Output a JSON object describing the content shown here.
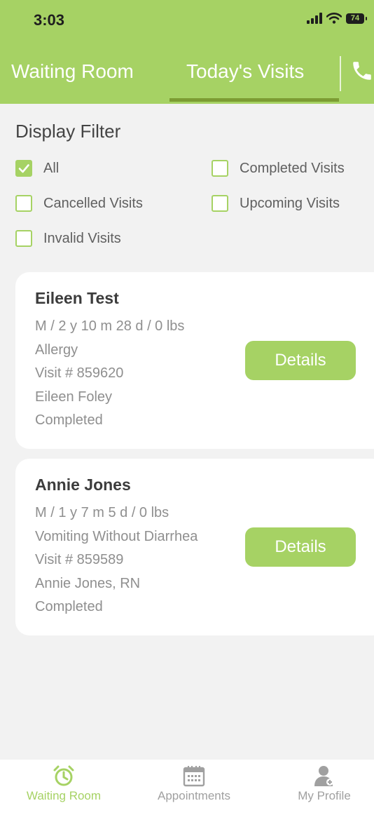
{
  "status_bar": {
    "time": "3:03",
    "battery": "74"
  },
  "tabs": [
    {
      "label": "Waiting Room",
      "active": false
    },
    {
      "label": "Today's Visits",
      "active": true
    }
  ],
  "filter": {
    "title": "Display Filter",
    "options": [
      {
        "label": "All",
        "checked": true
      },
      {
        "label": "Completed Visits",
        "checked": false
      },
      {
        "label": "Cancelled Visits",
        "checked": false
      },
      {
        "label": "Upcoming Visits",
        "checked": false
      },
      {
        "label": "Invalid Visits",
        "checked": false
      }
    ]
  },
  "visits": [
    {
      "name": "Eileen Test",
      "demographics": "M / 2 y  10 m  28 d  / 0 lbs",
      "reason": "Allergy",
      "visit_number": "Visit # 859620",
      "provider": "Eileen Foley",
      "status": "Completed",
      "button_label": "Details"
    },
    {
      "name": "Annie Jones",
      "demographics": "M / 1 y  7 m  5 d  / 0 lbs",
      "reason": "Vomiting Without Diarrhea",
      "visit_number": "Visit # 859589",
      "provider": "Annie Jones, RN",
      "status": "Completed",
      "button_label": "Details"
    }
  ],
  "bottom_nav": [
    {
      "label": "Waiting Room",
      "icon": "alarm-clock-icon",
      "active": true
    },
    {
      "label": "Appointments",
      "icon": "calendar-icon",
      "active": false
    },
    {
      "label": "My Profile",
      "icon": "user-icon",
      "active": false
    }
  ],
  "colors": {
    "accent": "#a6d264",
    "tab_underline": "#7c9c33",
    "background": "#f2f2f2",
    "inactive_nav": "#a0a0a0"
  }
}
